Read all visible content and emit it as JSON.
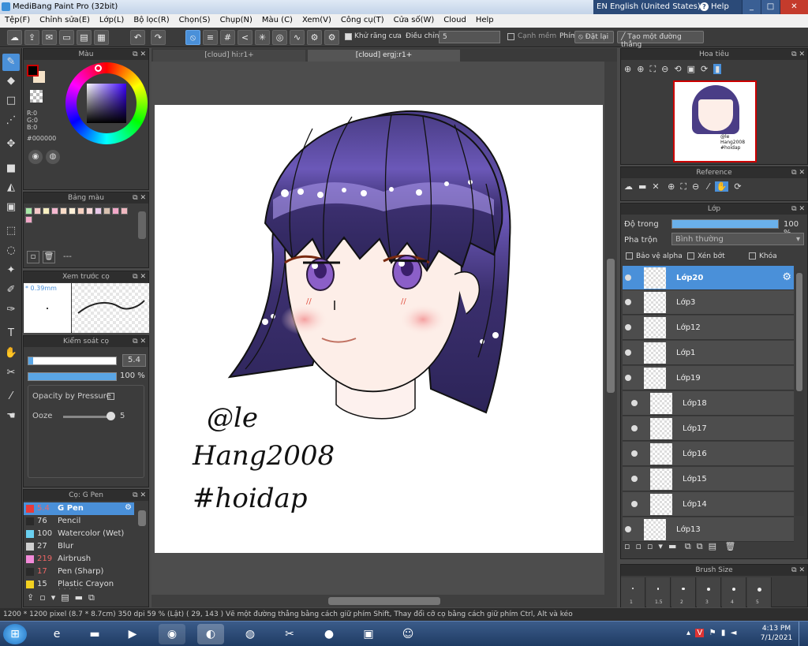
{
  "window": {
    "title": "MediBang Paint Pro (32bit)",
    "lang": "EN English (United States)",
    "help": "Help",
    "min": "_",
    "max": "□",
    "close": "✕"
  },
  "menu": [
    "Tệp(F)",
    "Chỉnh sửa(E)",
    "Lớp(L)",
    "Bộ lọc(R)",
    "Chọn(S)",
    "Chụp(N)",
    "Màu (C)",
    "Xem(V)",
    "Công cụ(T)",
    "Cửa số(W)",
    "Cloud",
    "Help"
  ],
  "toolbar": {
    "antialias": "Khử răng cưa",
    "correction_label": "Điều chỉnh",
    "correction_value": "5",
    "soft_edge": "Cạnh mềm",
    "pen_label": "Phím",
    "reset": "Đặt lại",
    "straight_line": "Tạo một đường thẳng"
  },
  "color_panel": {
    "title": "Màu",
    "r": "R:0",
    "g": "G:0",
    "b": "B:0",
    "hex": "#000000"
  },
  "palette_panel": {
    "title": "Bảng màu",
    "dash": "---"
  },
  "brush_preview": {
    "title": "Xem trước cọ",
    "size": "* 0.39mm"
  },
  "brush_control": {
    "title": "Kiểm soát cọ",
    "size_value": "5.4",
    "opacity_value": "100 %",
    "opacity_fraction": 1.0,
    "size_fraction": 0.05,
    "opacity_pressure": "Opacity by Pressure",
    "ooze_label": "Ooze",
    "ooze_value": "5"
  },
  "brush_list": {
    "title": "Cọ: G Pen",
    "items": [
      {
        "size": "5.4",
        "name": "G Pen",
        "color": "#e83a3a"
      },
      {
        "size": "76",
        "name": "Pencil",
        "color": "#2a2a2a"
      },
      {
        "size": "100",
        "name": "Watercolor (Wet)",
        "color": "#6ad0f0"
      },
      {
        "size": "27",
        "name": "Blur",
        "color": "#cfcfcf"
      },
      {
        "size": "219",
        "name": "Airbrush",
        "color": "#f28ad8"
      },
      {
        "size": "17",
        "name": "Pen (Sharp)",
        "color": "#2a2a2a"
      },
      {
        "size": "15",
        "name": "Plastic Crayon (thick)",
        "color": "#f2d020"
      }
    ]
  },
  "tabs": [
    "[cloud] hi:r1+",
    "[cloud] ergj:r1+"
  ],
  "artwork": {
    "signature_line1": "@le",
    "signature_line2": "Hang2008",
    "signature_line3": "#hoidap"
  },
  "navigator": {
    "title": "Hoa tiêu",
    "thumb_text": "@le Hang2008 #hoidap"
  },
  "reference": {
    "title": "Reference"
  },
  "layer_panel": {
    "title": "Lớp",
    "opacity_label": "Độ trong",
    "opacity_value": "100 %",
    "opacity_fraction": 1.0,
    "blend_label": "Pha trộn",
    "blend_value": "Bình thường",
    "protect_alpha": "Bảo vệ alpha",
    "clipping": "Xén bớt",
    "lock": "Khóa",
    "layers": [
      "Lớp20",
      "Lớp3",
      "Lớp12",
      "Lớp1",
      "Lớp19",
      "Lớp18",
      "Lớp17",
      "Lớp16",
      "Lớp15",
      "Lớp14",
      "Lớp13"
    ]
  },
  "brush_size": {
    "title": "Brush Size",
    "sizes": [
      "1",
      "1.5",
      "2",
      "3",
      "4",
      "5"
    ]
  },
  "status": "1200 * 1200 pixel   (8.7 * 8.7cm)   350 dpi   59 % (Lật)   ( 29, 143 )   Vẽ một đường thẳng bằng cách giữ phím Shift, Thay đổi cỡ cọ bằng cách giữ phím Ctrl, Alt và kéo",
  "clock": {
    "time": "4:13 PM",
    "date": "7/1/2021"
  },
  "colors": {
    "accent": "#4a90d9",
    "hair": "#3b2f6e",
    "skin": "#fdeee8"
  }
}
